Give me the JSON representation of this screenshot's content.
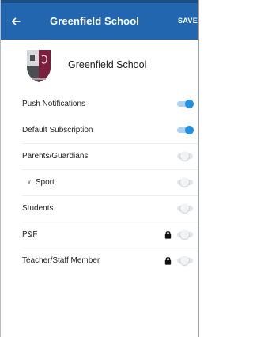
{
  "appbar": {
    "title": "Greenfield School",
    "save_label": "SAVE",
    "back_icon": "arrow-left-icon",
    "color": "#2266b0"
  },
  "school": {
    "name": "Greenfield School",
    "crest_icon": "school-crest-icon"
  },
  "settings": [
    {
      "label": "Push Notifications",
      "on": true,
      "locked": false,
      "indent": false
    },
    {
      "label": "Default Subscription",
      "on": true,
      "locked": false,
      "indent": false
    },
    {
      "label": "Parents/Guardians",
      "on": false,
      "locked": false,
      "indent": false
    },
    {
      "label": "Sport",
      "on": false,
      "locked": false,
      "indent": true,
      "expander": "chevron-down-icon"
    },
    {
      "label": "Students",
      "on": false,
      "locked": false,
      "indent": false
    },
    {
      "label": "P&F",
      "on": false,
      "locked": true,
      "indent": false
    },
    {
      "label": "Teacher/Staff Member",
      "on": false,
      "locked": true,
      "indent": false
    }
  ],
  "colors": {
    "toggle_on": "#2492e0",
    "toggle_off": "#e3e5e8"
  }
}
